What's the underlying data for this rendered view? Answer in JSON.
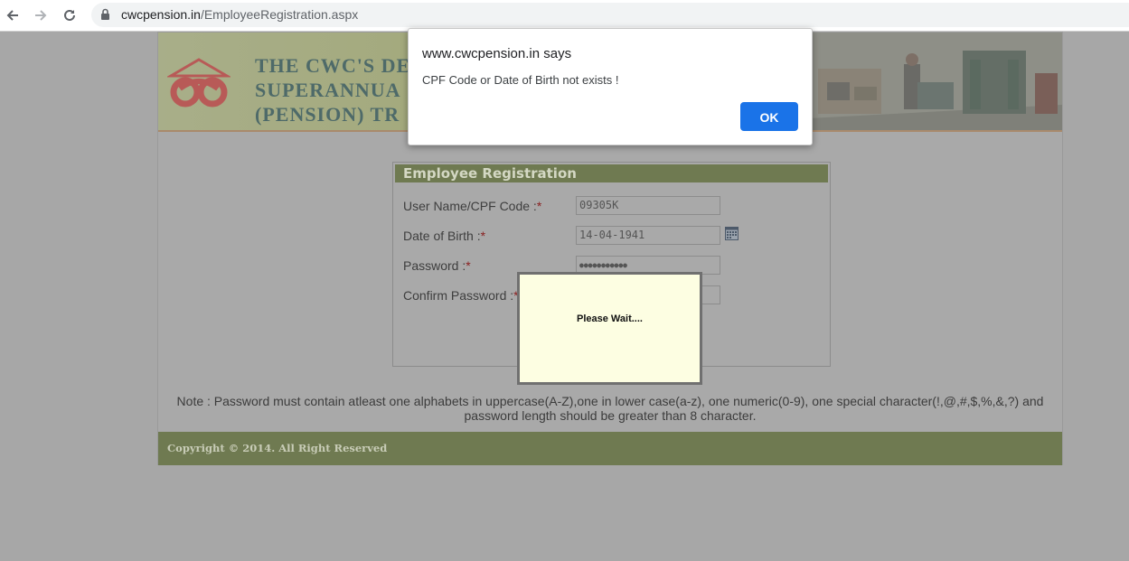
{
  "browser": {
    "url_host": "cwcpension.in",
    "url_path": "/EmployeeRegistration.aspx"
  },
  "banner": {
    "title_lines": [
      "THE CWC'S DE",
      "SUPERANNUA",
      "(PENSION) TR"
    ]
  },
  "registration": {
    "header": "Employee Registration",
    "fields": [
      {
        "label": "User Name/CPF Code :",
        "required": "*",
        "value": "09305K"
      },
      {
        "label": "Date of Birth :",
        "required": "*",
        "value": "14-04-1941"
      },
      {
        "label": "Password :",
        "required": "*",
        "value": "●●●●●●●●●●●"
      },
      {
        "label": "Confirm Password :",
        "required": "*",
        "value": ""
      }
    ]
  },
  "note": {
    "line1": "Note :  Password must contain atleast one alphabets in uppercase(A-Z),one in lower case(a-z), one numeric(0-9), one special character(!,@,#,$,%,&,?) and",
    "line2": "password length should be greater than 8 character."
  },
  "footer": {
    "copyright": "Copyright © 2014. All Right Reserved"
  },
  "wait_box": {
    "text": "Please Wait...."
  },
  "dialog": {
    "title": "www.cwcpension.in says",
    "message": "CPF Code or Date of Birth not exists !",
    "ok_label": "OK"
  },
  "colors": {
    "dialog_button": "#1a73e8",
    "panel_header": "#6f7a51",
    "wait_background": "#fdfee2"
  }
}
